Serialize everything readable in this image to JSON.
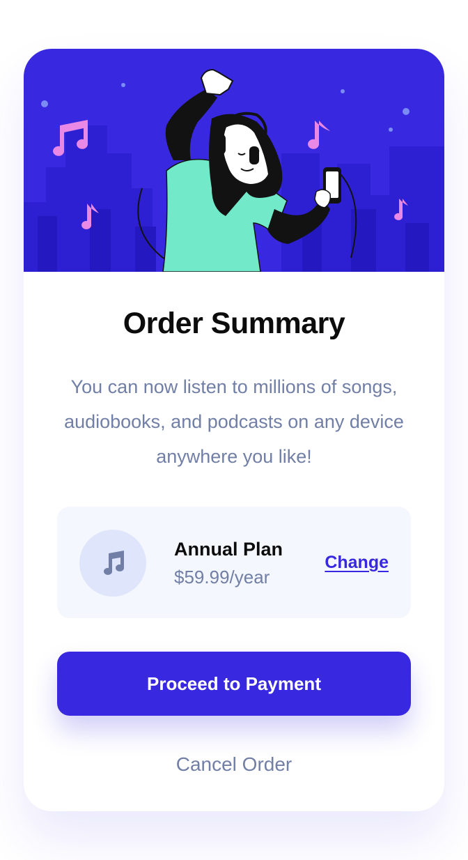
{
  "order": {
    "title": "Order Summary",
    "description": "You can now listen to millions of songs, audiobooks, and podcasts on any device anywhere you like!",
    "plan": {
      "icon": "music-note-icon",
      "name": "Annual Plan",
      "price": "$59.99/year",
      "change_label": "Change"
    },
    "proceed_label": "Proceed to Payment",
    "cancel_label": "Cancel Order"
  },
  "colors": {
    "brand": "#3829e0",
    "text_dark": "#0c0c0c",
    "text_muted": "#717fa6",
    "plan_bg": "#f5f7ff",
    "icon_bg": "#dfe6fb",
    "accent_green": "#72e9c8",
    "note_pink": "#ea89e5"
  }
}
